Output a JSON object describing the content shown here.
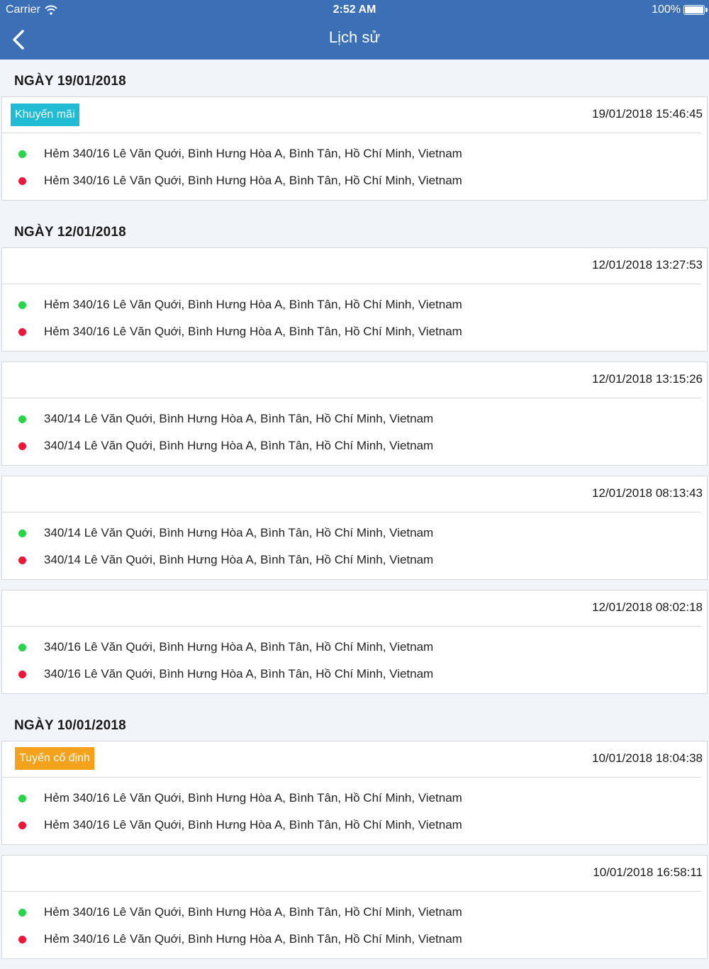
{
  "status": {
    "carrier": "Carrier",
    "time": "2:52 AM",
    "battery": "100%"
  },
  "nav": {
    "title": "Lịch sử"
  },
  "groups": [
    {
      "day": "NGÀY 19/01/2018",
      "trips": [
        {
          "tag": "Khuyến mãi",
          "timestamp": "19/01/2018 15:46:45",
          "from": "Hẻm 340/16 Lê Văn Quới, Bình Hưng Hòa A, Bình Tân, Hồ Chí Minh, Vietnam",
          "to": "Hẻm 340/16 Lê Văn Quới, Bình Hưng Hòa A, Bình Tân, Hồ Chí Minh, Vietnam"
        }
      ]
    },
    {
      "day": "NGÀY 12/01/2018",
      "trips": [
        {
          "timestamp": "12/01/2018 13:27:53",
          "from": "Hẻm 340/16 Lê Văn Quới, Bình Hưng Hòa A, Bình Tân, Hồ Chí Minh, Vietnam",
          "to": "Hẻm 340/16 Lê Văn Quới, Bình Hưng Hòa A, Bình Tân, Hồ Chí Minh, Vietnam"
        },
        {
          "timestamp": "12/01/2018 13:15:26",
          "from": "340/14 Lê Văn Quới, Bình Hưng Hòa A, Bình Tân, Hồ Chí Minh, Vietnam",
          "to": "340/14 Lê Văn Quới, Bình Hưng Hòa A, Bình Tân, Hồ Chí Minh, Vietnam"
        },
        {
          "timestamp": "12/01/2018 08:13:43",
          "from": "340/14 Lê Văn Quới, Bình Hưng Hòa A, Bình Tân, Hồ Chí Minh, Vietnam",
          "to": "340/14 Lê Văn Quới, Bình Hưng Hòa A, Bình Tân, Hồ Chí Minh, Vietnam"
        },
        {
          "timestamp": "12/01/2018 08:02:18",
          "from": "340/16 Lê Văn Quới, Bình Hưng Hòa A, Bình Tân, Hồ Chí Minh, Vietnam",
          "to": "340/16 Lê Văn Quới, Bình Hưng Hòa A, Bình Tân, Hồ Chí Minh, Vietnam"
        }
      ]
    },
    {
      "day": "NGÀY 10/01/2018",
      "trips": [
        {
          "tag": "Tuyến cố định",
          "timestamp": "10/01/2018 18:04:38",
          "from": "Hẻm 340/16 Lê Văn Quới, Bình Hưng Hòa A, Bình Tân, Hồ Chí Minh, Vietnam",
          "to": "Hẻm 340/16 Lê Văn Quới, Bình Hưng Hòa A, Bình Tân, Hồ Chí Minh, Vietnam"
        },
        {
          "timestamp": "10/01/2018 16:58:11",
          "from": "Hẻm 340/16 Lê Văn Quới, Bình Hưng Hòa A, Bình Tân, Hồ Chí Minh, Vietnam",
          "to": "Hẻm 340/16 Lê Văn Quới, Bình Hưng Hòa A, Bình Tân, Hồ Chí Minh, Vietnam"
        }
      ]
    }
  ],
  "colors": {
    "nav_bg": "#3b6fb6",
    "promo_tag": "#1fbcd3",
    "fixed_tag": "#f4a11b",
    "start_dot": "#26d54a",
    "end_dot": "#f0163a"
  },
  "icons": {
    "back": "chevron-left-icon",
    "wifi": "wifi-icon",
    "battery": "battery-icon",
    "start": "green-dot-icon",
    "end": "red-dot-icon"
  }
}
